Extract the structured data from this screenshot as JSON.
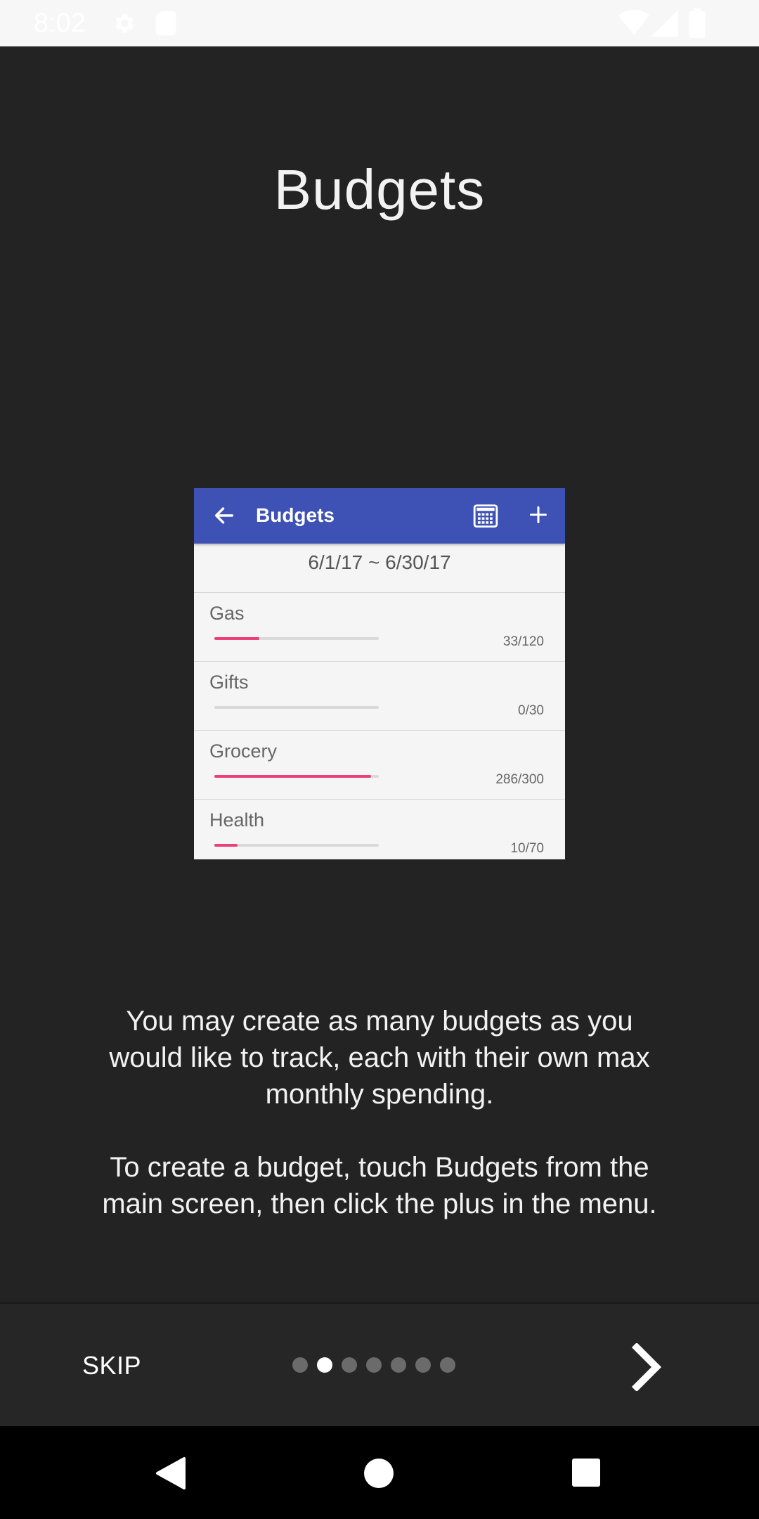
{
  "status_bar": {
    "time": "8:02",
    "icons": [
      "gear-icon",
      "sd-card-icon",
      "wifi-icon",
      "signal-icon",
      "battery-icon"
    ]
  },
  "page": {
    "title": "Budgets",
    "description": [
      "You may create as many budgets as you would like to track, each with their own max monthly spending.",
      "To create a budget, touch Budgets from the main screen, then click the plus in the menu."
    ]
  },
  "preview": {
    "appbar_title": "Budgets",
    "date_range": "6/1/17 ~ 6/30/17",
    "accent_color": "#3e51b5",
    "progress_color": "#ec407a",
    "budgets": [
      {
        "name": "Gas",
        "amount": "33/120",
        "progress": 0.275
      },
      {
        "name": "Gifts",
        "amount": "0/30",
        "progress": 0
      },
      {
        "name": "Grocery",
        "amount": "286/300",
        "progress": 0.953
      },
      {
        "name": "Health",
        "amount": "10/70",
        "progress": 0.143
      }
    ]
  },
  "intro_nav": {
    "skip_label": "SKIP",
    "page_count": 7,
    "current_page": 2,
    "next_icon": "chevron-right-icon"
  },
  "system_nav": {
    "icons": [
      "back-triangle-icon",
      "home-circle-icon",
      "recents-square-icon"
    ]
  }
}
